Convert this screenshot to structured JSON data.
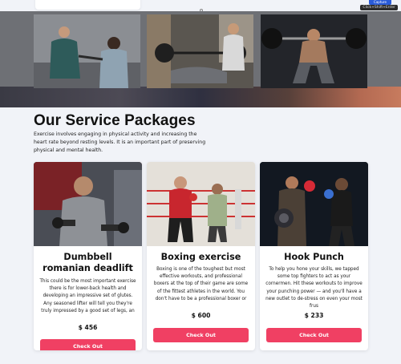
{
  "top_overlay": {
    "ext_badge": "Capture",
    "ext_tooltip": "Click+Shift+Enter"
  },
  "services": {
    "title": "Our Service Packages",
    "description": "Exercise involves engaging in physical activity and increasing the heart rate beyond resting levels. It is an important part of preserving physical and mental health."
  },
  "packages": [
    {
      "title": "Dumbbell romanian deadlift",
      "description": "This could be the most important exercise there is for lower-back health and developing an impressive set of glutes. Any seasoned lifter will tell you they're truly impressed by a good set of legs, an",
      "price": "$ 456",
      "button": "Check Out"
    },
    {
      "title": "Boxing exercise",
      "description": "Boxing is one of the toughest but most effective workouts, and professional boxers at the top of their game are some of the fittest athletes in the world. You don't have to be a professional boxer or",
      "price": "$ 600",
      "button": "Check Out"
    },
    {
      "title": "Hook Punch",
      "description": "To help you hone your skills, we tapped some top fighters to act as your cornermen. Hit these workouts to improve your punching power — and you'll have a new outlet to de-stress on even your most frus",
      "price": "$ 233",
      "button": "Check Out"
    }
  ],
  "colors": {
    "accent": "#f04063",
    "page_bg": "#f1f3f8",
    "card_bg": "#ffffff"
  }
}
